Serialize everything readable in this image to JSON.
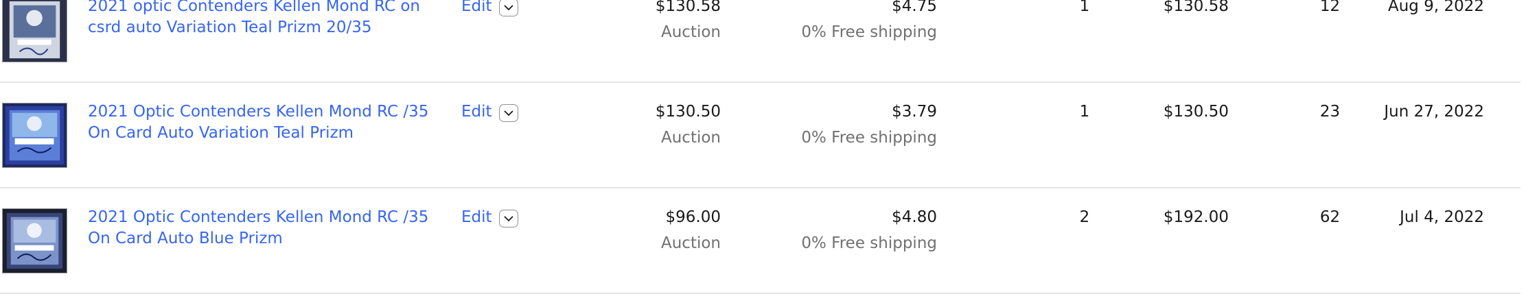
{
  "listings": [
    {
      "title": "2021 optic Contenders Kellen Mond RC on csrd auto Variation Teal Prizm 20/35",
      "edit_label": "Edit",
      "price": "$130.58",
      "format": "Auction",
      "shipping": "$4.75",
      "shipping_note": "0% Free shipping",
      "quantity": "1",
      "total": "$130.58",
      "watchers": "12",
      "date": "Aug 9, 2022"
    },
    {
      "title": "2021 Optic Contenders Kellen Mond RC /35 On Card Auto Variation Teal Prizm",
      "edit_label": "Edit",
      "price": "$130.50",
      "format": "Auction",
      "shipping": "$3.79",
      "shipping_note": "0% Free shipping",
      "quantity": "1",
      "total": "$130.50",
      "watchers": "23",
      "date": "Jun 27, 2022"
    },
    {
      "title": "2021 Optic Contenders Kellen Mond RC /35 On Card Auto Blue Prizm",
      "edit_label": "Edit",
      "price": "$96.00",
      "format": "Auction",
      "shipping": "$4.80",
      "shipping_note": "0% Free shipping",
      "quantity": "2",
      "total": "$192.00",
      "watchers": "62",
      "date": "Jul 4, 2022"
    }
  ],
  "icons": {
    "edit_caret": "chevron-down-icon",
    "thumbnail": "trading-card-thumbnail"
  },
  "colors": {
    "link": "#3665f3",
    "secondary_text": "#707070",
    "primary_text": "#191919",
    "divider": "#e5e5e5"
  }
}
